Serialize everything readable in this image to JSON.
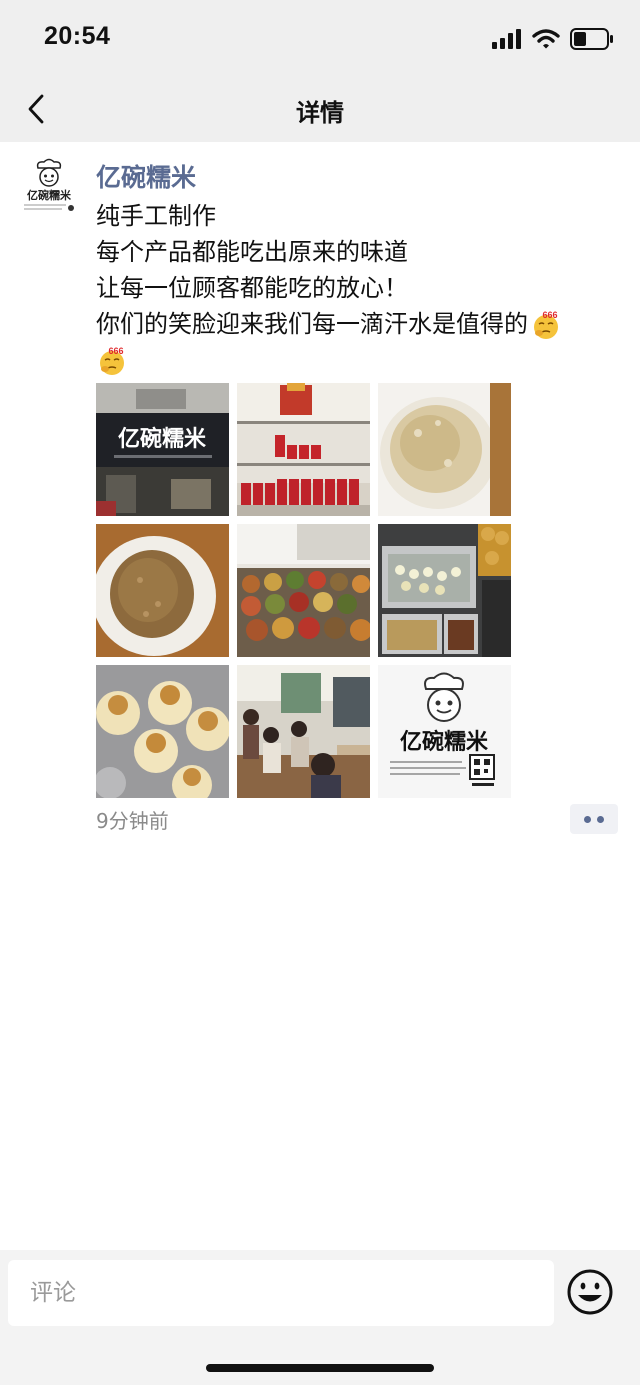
{
  "status_bar": {
    "time": "20:54"
  },
  "nav": {
    "title": "详情"
  },
  "post": {
    "author": "亿碗糯米",
    "lines": [
      "纯手工制作",
      "每个产品都能吃出原来的味道",
      "让每一位顾客都能吃的放心！",
      "你们的笑脸迎来我们每一滴汗水是值得的"
    ],
    "emoji_badge": "666",
    "emoji_icon": "emoji-666-icon",
    "photos": [
      {
        "name": "storefront-photo",
        "sign_text": "亿碗糯米"
      },
      {
        "name": "drink-shelf-photo"
      },
      {
        "name": "glutinous-rice-photo"
      },
      {
        "name": "steamed-rice-photo"
      },
      {
        "name": "side-dishes-photo"
      },
      {
        "name": "food-trays-photo"
      },
      {
        "name": "shaomai-photo"
      },
      {
        "name": "customers-photo"
      },
      {
        "name": "logo-card-photo",
        "brand_text": "亿碗糯米"
      }
    ],
    "time_ago": "9分钟前"
  },
  "comment": {
    "placeholder": "评论"
  },
  "colors": {
    "author": "#5a6b92",
    "nav_bg": "#efefef",
    "timestamp": "#8a8a8a"
  }
}
